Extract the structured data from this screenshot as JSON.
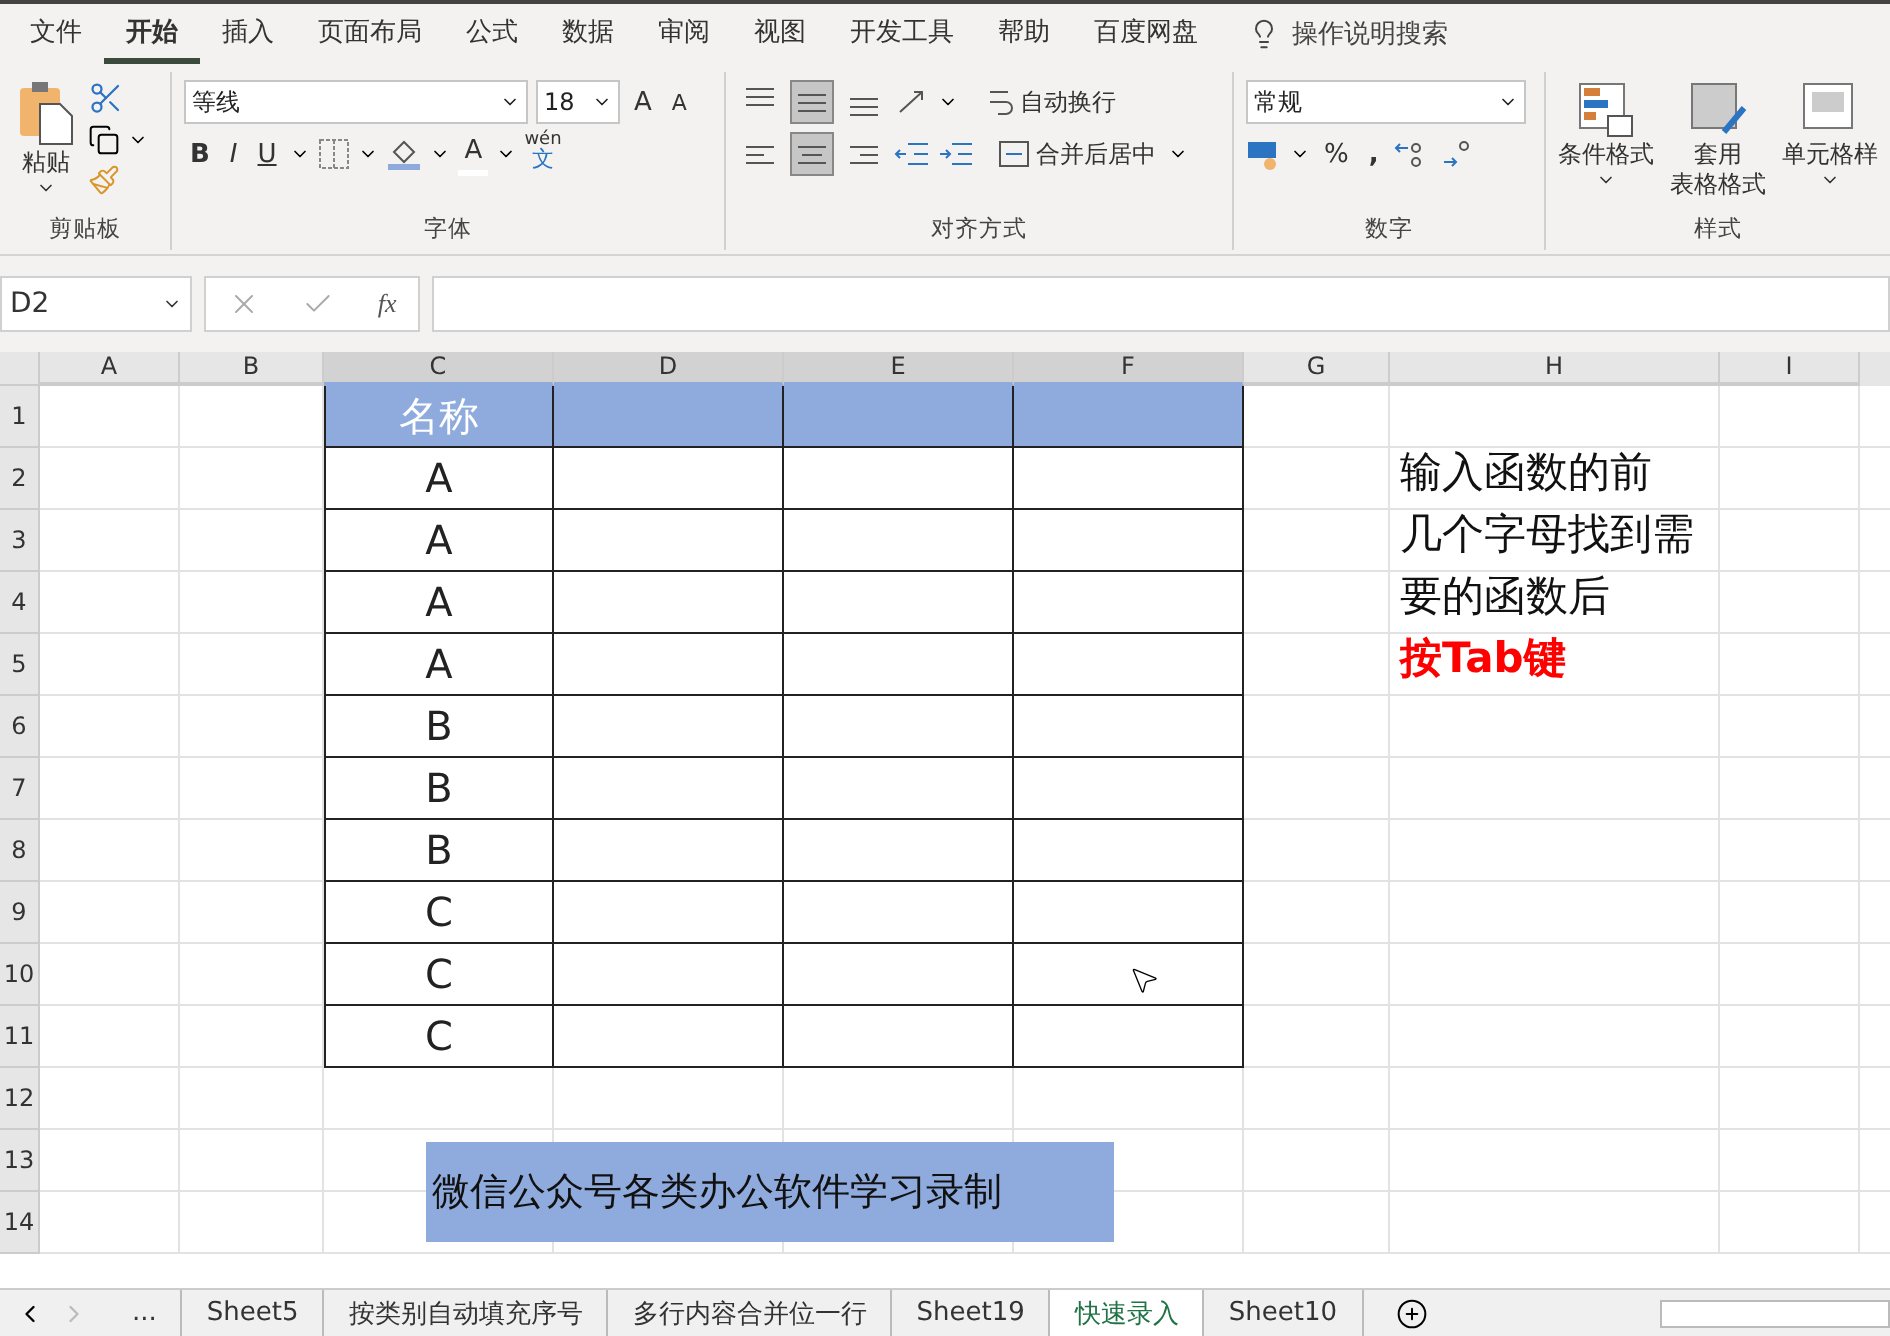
{
  "menu_tabs": [
    {
      "label": "文件",
      "selected": false
    },
    {
      "label": "开始",
      "selected": true
    },
    {
      "label": "插入",
      "selected": false
    },
    {
      "label": "页面布局",
      "selected": false
    },
    {
      "label": "公式",
      "selected": false
    },
    {
      "label": "数据",
      "selected": false
    },
    {
      "label": "审阅",
      "selected": false
    },
    {
      "label": "视图",
      "selected": false
    },
    {
      "label": "开发工具",
      "selected": false
    },
    {
      "label": "帮助",
      "selected": false
    },
    {
      "label": "百度网盘",
      "selected": false
    }
  ],
  "tell_me": "操作说明搜索",
  "clipboard": {
    "paste": "粘贴",
    "group": "剪贴板"
  },
  "font": {
    "name": "等线",
    "size": "18",
    "grow": "A",
    "shrink": "A",
    "bold": "B",
    "italic": "I",
    "underline": "U",
    "font_color": "A",
    "phonetic_top": "wén",
    "phonetic_bottom": "文",
    "group": "字体"
  },
  "alignment": {
    "vertical": [
      {
        "kind": "top",
        "selected": false
      },
      {
        "kind": "middle",
        "selected": true
      },
      {
        "kind": "bottom",
        "selected": false
      }
    ],
    "horizontal": [
      {
        "kind": "left",
        "selected": false
      },
      {
        "kind": "center",
        "selected": true
      },
      {
        "kind": "right",
        "selected": false
      }
    ],
    "wrap": "自动换行",
    "merge": "合并后居中",
    "group": "对齐方式"
  },
  "number": {
    "format": "常规",
    "percent": "%",
    "comma": ",",
    "group": "数字"
  },
  "styles": {
    "conditional": "条件格式",
    "table_format_1": "套用",
    "table_format_2": "表格格式",
    "cell_styles": "单元格样",
    "group": "样式"
  },
  "formula_bar": {
    "name_box": "D2",
    "fx": "fx"
  },
  "columns": [
    {
      "label": "A",
      "selected": false
    },
    {
      "label": "B",
      "selected": false
    },
    {
      "label": "C",
      "selected": true
    },
    {
      "label": "D",
      "selected": true
    },
    {
      "label": "E",
      "selected": true
    },
    {
      "label": "F",
      "selected": true
    },
    {
      "label": "G",
      "selected": false
    },
    {
      "label": "H",
      "selected": false
    },
    {
      "label": "I",
      "selected": false
    }
  ],
  "rows": [
    "1",
    "2",
    "3",
    "4",
    "5",
    "6",
    "7",
    "8",
    "9",
    "10",
    "11",
    "12",
    "13",
    "14"
  ],
  "table": {
    "header": "名称",
    "values": [
      "A",
      "A",
      "A",
      "A",
      "B",
      "B",
      "B",
      "C",
      "C",
      "C"
    ]
  },
  "note": [
    {
      "text": "输入函数的前",
      "kind": "plain"
    },
    {
      "text": "几个字母找到需",
      "kind": "plain"
    },
    {
      "text": "要的函数后",
      "kind": "plain"
    },
    {
      "text": "按Tab键",
      "kind": "emphasis"
    }
  ],
  "banner": "微信公众号各类办公软件学习录制",
  "sheet_tabs": {
    "more": "...",
    "tabs": [
      {
        "label": "Sheet5",
        "selected": false
      },
      {
        "label": "按类别自动填充序号",
        "selected": false
      },
      {
        "label": "多行内容合并位一行",
        "selected": false
      },
      {
        "label": "Sheet19",
        "selected": false
      },
      {
        "label": "快速录入",
        "selected": true
      },
      {
        "label": "Sheet10",
        "selected": false
      }
    ]
  }
}
